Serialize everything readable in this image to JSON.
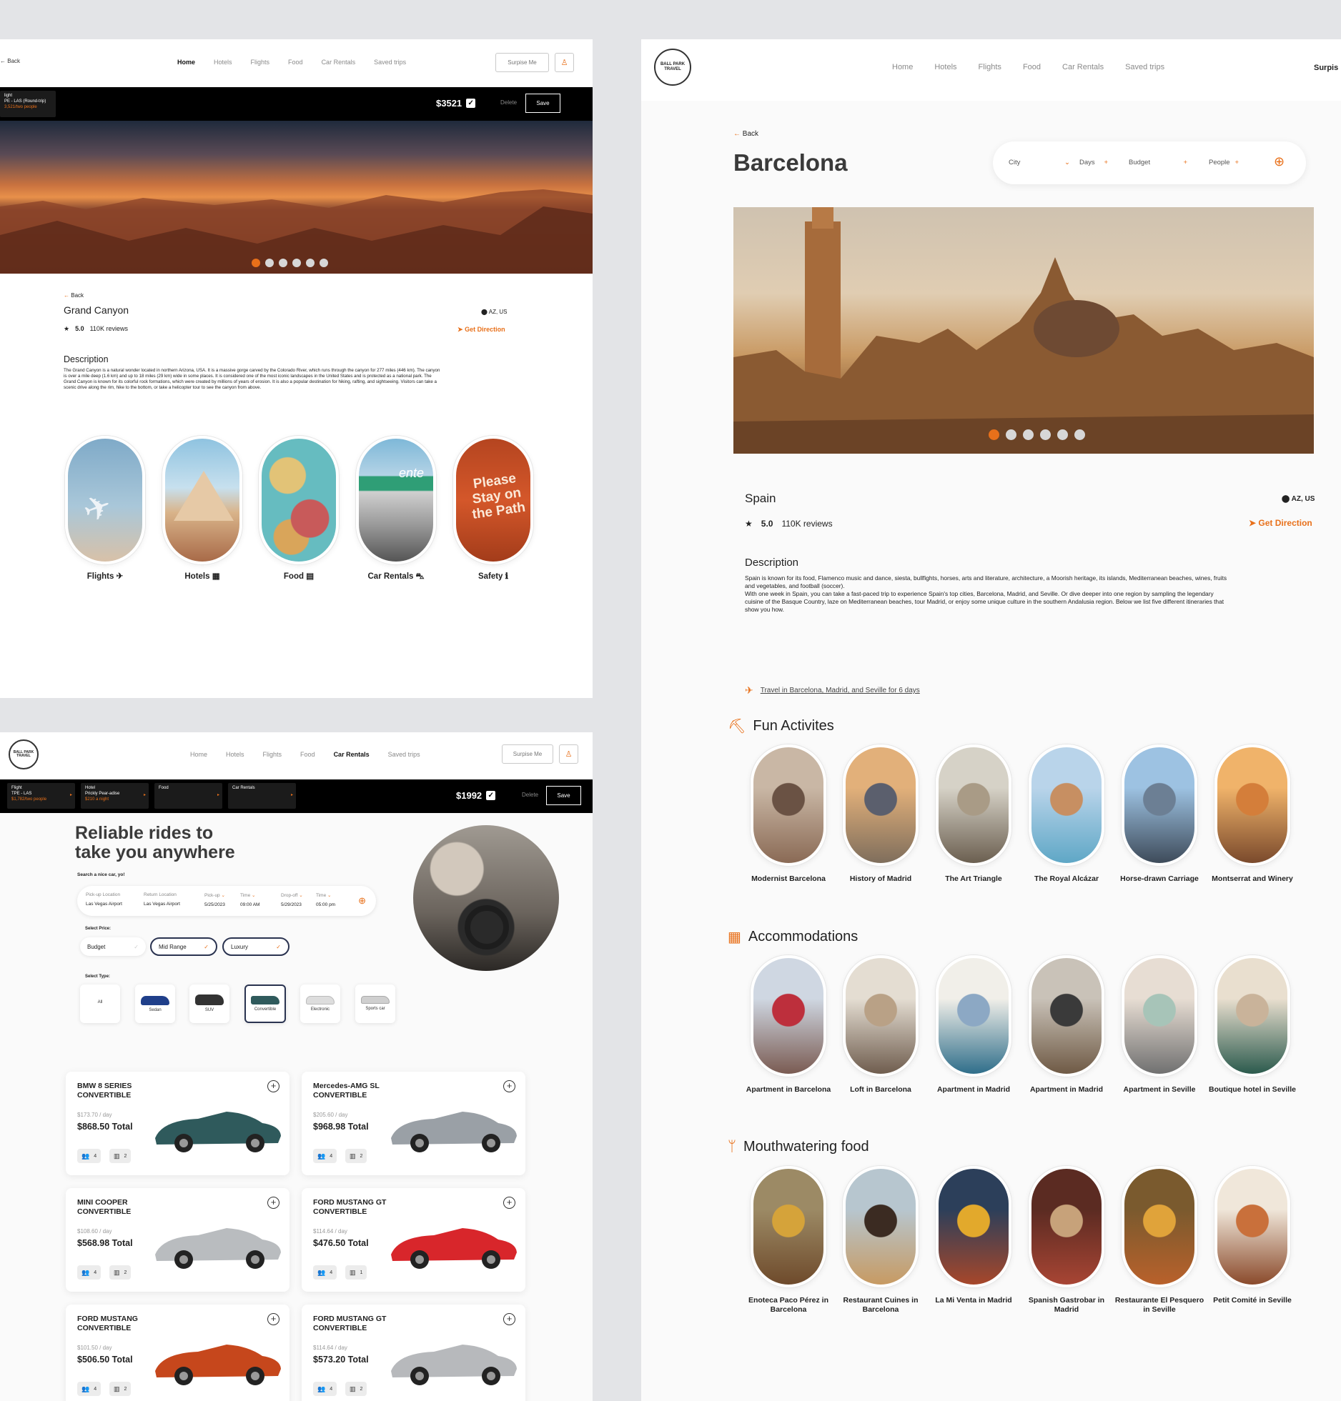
{
  "grand": {
    "nav": {
      "back": "Back",
      "items": [
        "Home",
        "Hotels",
        "Flights",
        "Food",
        "Car Rentals",
        "Saved trips"
      ],
      "active": "Home",
      "surprise": "Surpise Me"
    },
    "bar": {
      "flight_label": "light",
      "flight_route": "PE - LAS (Round-trip)",
      "flight_price": "3,521/two people",
      "total": "$3521",
      "delete": "Delete",
      "save": "Save"
    },
    "back": "Back",
    "title": "Grand Canyon",
    "location": "AZ, US",
    "rating": "5.0",
    "reviews": "110K  reviews",
    "get_direction": "Get Direction",
    "desc_heading": "Description",
    "description": "The Grand Canyon is a natural wonder located in northern Arizona, USA. It is a massive gorge carved by the Colorado River, which runs through the canyon for 277 miles (446 km). The canyon is over a mile deep (1.6 km) and up to 18 miles (29 km) wide in some places. It is considered one of the most iconic landscapes in the United States and is protected as a national park. The Grand Canyon is known for its colorful rock formations, which were created by millions of years of erosion. It is also a popular destination for hiking, rafting, and sightseeing. Visitors can take a scenic drive along the rim, hike to the bottom, or take a helicopter tour to see the canyon from above.",
    "categories": [
      {
        "label": "Flights",
        "icon": "plane-icon",
        "glyph": "✈"
      },
      {
        "label": "Hotels",
        "icon": "building-icon",
        "glyph": "▦"
      },
      {
        "label": "Food",
        "icon": "food-icon",
        "glyph": "▤"
      },
      {
        "label": "Car Rentals",
        "icon": "car-icon",
        "glyph": "⛍"
      },
      {
        "label": "Safety",
        "icon": "info-icon",
        "glyph": "ℹ"
      }
    ],
    "safety_sign": "Please Stay on the Path"
  },
  "cars": {
    "nav": {
      "items": [
        "Home",
        "Hotels",
        "Flights",
        "Food",
        "Car Rentals",
        "Saved trips"
      ],
      "active": "Car Rentals",
      "surprise": "Surpise Me"
    },
    "logo": "BALL PARK TRAVEL",
    "bar": {
      "flight_label": "Flight",
      "flight_route": "TPE - LAS",
      "flight_price": "$1,782/two people",
      "hotel_label": "Hotel",
      "hotel_name": "Prickly Pear-adise",
      "hotel_price": "$210 a night",
      "food_label": "Food",
      "car_label": "Car Rentals",
      "total": "$1992",
      "delete": "Delete",
      "save": "Save"
    },
    "headline1": "Reliable rides to",
    "headline2": "take you anywhere",
    "search_hint": "Search a nice car, yo!",
    "search": [
      {
        "label": "Pick-up Location",
        "value": "Las Vegas Airport"
      },
      {
        "label": "Return Location",
        "value": "Las Vegas Airport"
      },
      {
        "label": "Pick-up",
        "value": "5/25/2023"
      },
      {
        "label": "Time",
        "value": "09:00 AM"
      },
      {
        "label": "Drop-off",
        "value": "5/29/2023"
      },
      {
        "label": "Time",
        "value": "05:00 pm"
      }
    ],
    "price_label": "Select Price:",
    "prices": [
      "Budget",
      "Mid Range",
      "Luxury"
    ],
    "type_label": "Select Type:",
    "types": [
      "All",
      "Sedan",
      "SUV",
      "Convertible",
      "Electronic",
      "Sports car"
    ],
    "selected_type": "Convertible",
    "list": [
      {
        "name1": "BMW 8 SERIES",
        "name2": "CONVERTIBLE",
        "rate": "$173.70  / day",
        "total": "$868.50 Total",
        "seats": "4",
        "bags": "2",
        "color": "#2f5a5c"
      },
      {
        "name1": "Mercedes-AMG SL",
        "name2": "CONVERTIBLE",
        "rate": "$205.60  / day",
        "total": "$968.98 Total",
        "seats": "4",
        "bags": "2",
        "color": "#9aa0a6"
      },
      {
        "name1": "MINI COOPER",
        "name2": "CONVERTIBLE",
        "rate": "$108.60  / day",
        "total": "$568.98 Total",
        "seats": "4",
        "bags": "2",
        "color": "#b9bcbf"
      },
      {
        "name1": "FORD MUSTANG GT",
        "name2": "CONVERTIBLE",
        "rate": "$114.64  / day",
        "total": "$476.50 Total",
        "seats": "4",
        "bags": "1",
        "color": "#d8262b"
      },
      {
        "name1": "FORD MUSTANG",
        "name2": "CONVERTIBLE",
        "rate": "$101.50  / day",
        "total": "$506.50 Total",
        "seats": "4",
        "bags": "2",
        "color": "#c6471c"
      },
      {
        "name1": "FORD MUSTANG GT",
        "name2": "CONVERTIBLE",
        "rate": "$114.64  / day",
        "total": "$573.20 Total",
        "seats": "4",
        "bags": "2",
        "color": "#b7b9bc"
      }
    ]
  },
  "spain": {
    "logo": "BALL PARK TRAVEL",
    "nav": {
      "items": [
        "Home",
        "Hotels",
        "Flights",
        "Food",
        "Car Rentals",
        "Saved trips"
      ],
      "surprise": "Surpis"
    },
    "back": "Back",
    "city_title": "Barcelona",
    "filters": [
      "City",
      "Days",
      "Budget",
      "People"
    ],
    "country": "Spain",
    "location": "AZ, US",
    "rating": "5.0",
    "reviews": "110K  reviews",
    "get_direction": "Get Direction",
    "desc_heading": "Description",
    "description1": "Spain is known for its food, Flamenco music and dance, siesta, bullfights, horses, arts and literature, architecture, a Moorish heritage, its islands, Mediterranean beaches, wines, fruits and vegetables, and football (soccer).",
    "description2": "With one week in Spain, you can take a fast-paced trip to experience Spain's top cities, Barcelona, Madrid, and Seville. Or dive deeper into one region by sampling the legendary cuisine of the Basque Country, laze on Mediterranean beaches, tour Madrid, or enjoy some unique culture in the southern Andalusia region. Below we list five different itineraries that show you how.",
    "itinerary": "Travel in Barcelona, Madrid, and Seville for 6 days",
    "sections": [
      {
        "title": "Fun Activites",
        "icon": "hiker-icon",
        "items": [
          "Modernist Barcelona",
          "History of Madrid",
          "The Art Triangle",
          "The Royal Alcázar",
          "Horse-drawn Carriage",
          "Montserrat and Winery"
        ]
      },
      {
        "title": "Accommodations",
        "icon": "hotel-icon",
        "items": [
          "Apartment in Barcelona",
          "Loft in Barcelona",
          "Apartment in Madrid",
          "Apartment in Madrid",
          "Apartment in Seville",
          "Boutique hotel in Seville"
        ]
      },
      {
        "title": "Mouthwatering food",
        "icon": "utensils-icon",
        "items": [
          "Enoteca Paco Pérez in Barcelona",
          "Restaurant Cuines in Barcelona",
          "La Mi Venta in Madrid",
          "Spanish Gastrobar in Madrid",
          "Restaurante El Pesquero in Seville",
          "Petit Comité in Seville"
        ]
      }
    ]
  },
  "colors": {
    "accent": "#e8701a",
    "dark": "#000000",
    "navy": "#2a3350"
  }
}
